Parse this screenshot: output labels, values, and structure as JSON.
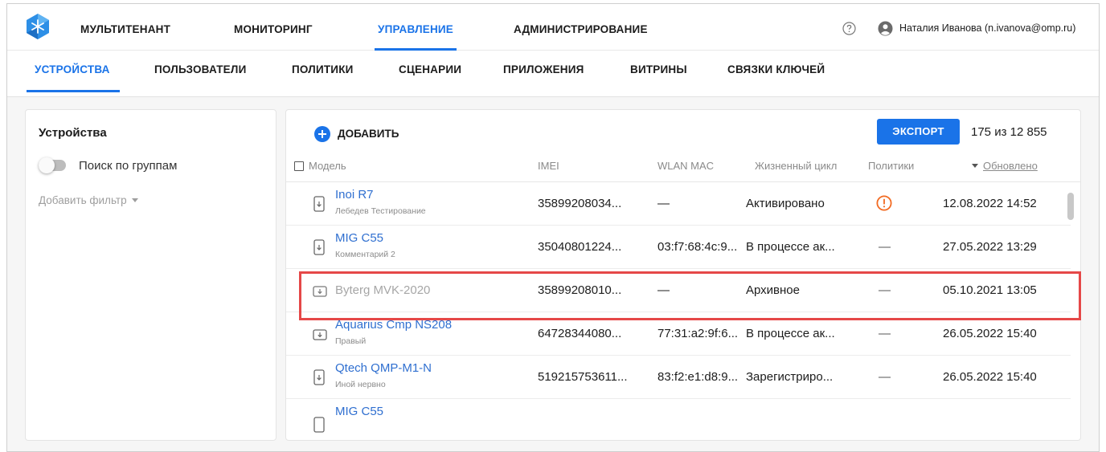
{
  "top_nav": {
    "items": [
      "МУЛЬТИТЕНАНТ",
      "МОНИТОРИНГ",
      "УПРАВЛЕНИЕ",
      "АДМИНИСТРИРОВАНИЕ"
    ],
    "active": "УПРАВЛЕНИЕ",
    "user": "Наталия Иванова (n.ivanova@omp.ru)"
  },
  "sub_nav": {
    "items": [
      "УСТРОЙСТВА",
      "ПОЛЬЗОВАТЕЛИ",
      "ПОЛИТИКИ",
      "СЦЕНАРИИ",
      "ПРИЛОЖЕНИЯ",
      "ВИТРИНЫ",
      "СВЯЗКИ КЛЮЧЕЙ"
    ],
    "active": "УСТРОЙСТВА"
  },
  "filters": {
    "title": "Устройства",
    "group_search_label": "Поиск по группам",
    "group_search_enabled": false,
    "add_filter_label": "Добавить фильтр"
  },
  "toolbar": {
    "add_label": "ДОБАВИТЬ",
    "export_label": "ЭКСПОРТ",
    "count": "175 из 12 855"
  },
  "table": {
    "columns": {
      "model": "Модель",
      "imei": "IMEI",
      "wlan": "WLAN MAC",
      "lifecycle": "Жизненный цикл",
      "policies": "Политики",
      "updated": "Обновлено"
    },
    "rows": [
      {
        "model": "Inoi R7",
        "sub": "Лебедев Тестирование",
        "imei": "35899208034...",
        "wlan": "—",
        "lifecycle": "Активировано",
        "policies": "warning",
        "updated": "12.08.2022 14:52",
        "device": "phone"
      },
      {
        "model": "MIG C55",
        "sub": "Комментарий 2",
        "imei": "35040801224...",
        "wlan": "03:f7:68:4c:9...",
        "lifecycle": "В процессе ак...",
        "policies": "—",
        "updated": "27.05.2022 13:29",
        "device": "phone"
      },
      {
        "model": "Byterg MVK-2020",
        "sub": "",
        "imei": "35899208010...",
        "wlan": "—",
        "lifecycle": "Архивное",
        "policies": "—",
        "updated": "05.10.2021 13:05",
        "device": "tablet",
        "archived": true
      },
      {
        "model": "Aquarius Cmp NS208",
        "sub": "Правый",
        "imei": "64728344080...",
        "wlan": "77:31:a2:9f:6...",
        "lifecycle": "В процессе ак...",
        "policies": "—",
        "updated": "26.05.2022 15:40",
        "device": "tablet"
      },
      {
        "model": "Qtech QMP-M1-N",
        "sub": "Иной нервно",
        "imei": "519215753611...",
        "wlan": "83:f2:e1:d8:9...",
        "lifecycle": "Зарегистриро...",
        "policies": "—",
        "updated": "26.05.2022 15:40",
        "device": "phone"
      },
      {
        "model": "MIG C55",
        "sub": "",
        "imei": "",
        "wlan": "",
        "lifecycle": "",
        "policies": "",
        "updated": "",
        "device": "phone"
      }
    ]
  },
  "colors": {
    "accent": "#1a73e8",
    "highlight": "#e54848",
    "warning": "#f26a21"
  }
}
